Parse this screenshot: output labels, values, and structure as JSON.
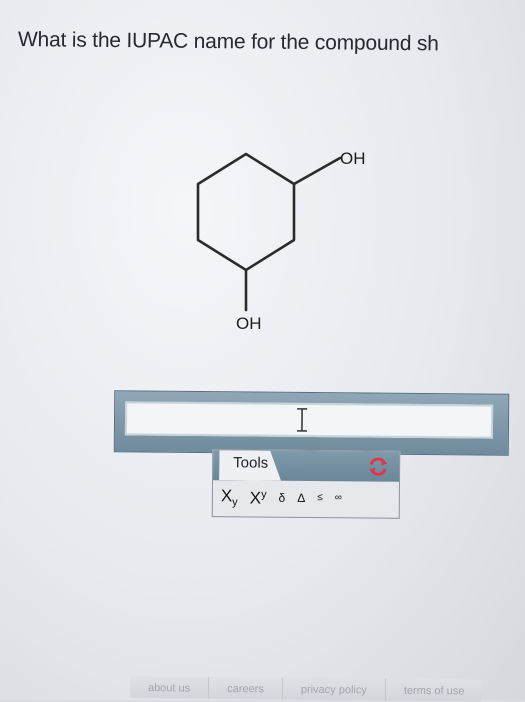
{
  "question": {
    "text": "What is the IUPAC name for the compound sh"
  },
  "molecule": {
    "label_top": "OH",
    "label_bottom": "OH"
  },
  "answer": {
    "value": "",
    "placeholder": ""
  },
  "tools": {
    "label": "Tools",
    "subscript_base": "X",
    "subscript_mark": "y",
    "superscript_base": "X",
    "superscript_mark": "y",
    "delta_lower": "δ",
    "delta_upper": "Δ",
    "less_equal": "≤",
    "infinity": "∞"
  },
  "footer": {
    "about": "about us",
    "careers": "careers",
    "privacy": "privacy policy",
    "terms": "terms of use"
  },
  "colors": {
    "editor_frame": "#7894a6",
    "refresh_accent": "#e0344a",
    "text": "#262a30"
  }
}
